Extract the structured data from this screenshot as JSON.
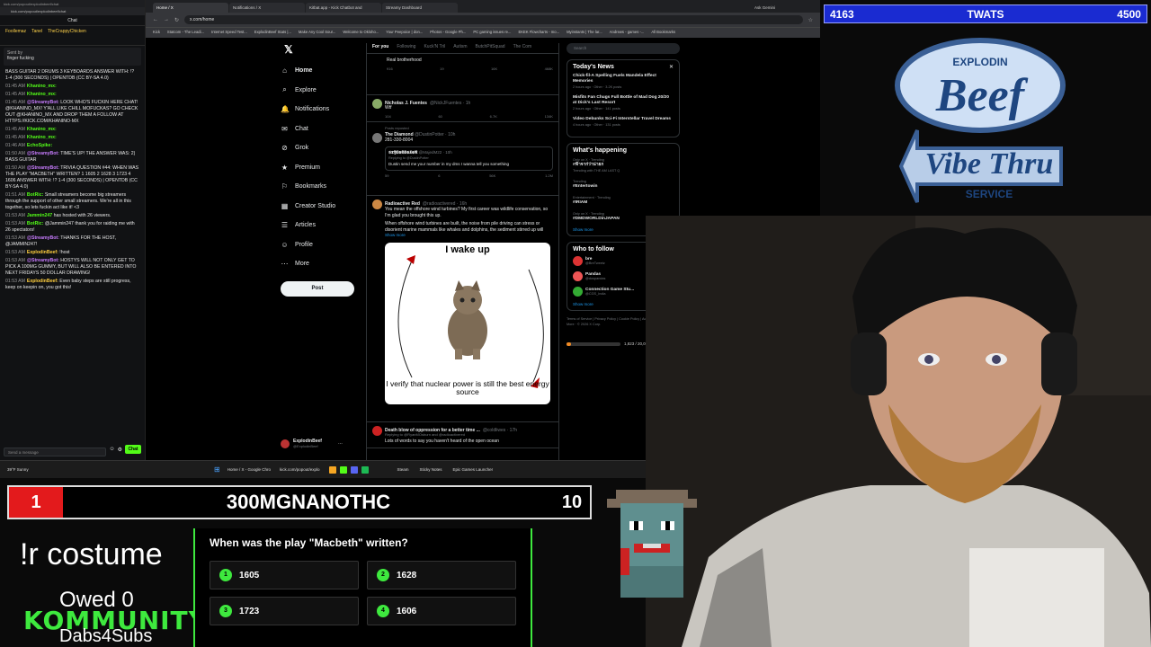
{
  "chat": {
    "url": "kick.com/popout/explodinbeef/chat",
    "title": "Chat",
    "top_gifters": [
      "Foollemaz",
      "Tanel",
      "TheCrappyChicken"
    ],
    "sent_by": "Sent by",
    "pinned_text": "finger fucking",
    "messages": [
      {
        "t": "",
        "u": "",
        "x": "BASS GUITAR 2 DRUMS 3 KEYBOARDS ANSWER WITH: !? 1-4 (300 SECONDS) | OPENTDB (CC BY-SA 4.0)"
      },
      {
        "t": "01:45 AM",
        "u": "Khanino_mx:",
        "x": ""
      },
      {
        "t": "01:45 AM",
        "u": "Khanino_mx:",
        "x": ""
      },
      {
        "t": "01:45 AM",
        "u": "@StreamyBot:",
        "x": "LOOK WHO'S FUCKIN HERE CHAT! @KHANINO_MX! Y'ALL LIKE CHILL MOFUCKAS? GO CHECK OUT @KHANINO_MX AND DROP THEM A FOLLOW AT HTTPS://KICK.COM/KHANINO-MX"
      },
      {
        "t": "01:45 AM",
        "u": "Khanino_mx:",
        "x": ""
      },
      {
        "t": "01:45 AM",
        "u": "Khanino_mx:",
        "x": ""
      },
      {
        "t": "01:46 AM",
        "u": "EchoSpike:",
        "x": ""
      },
      {
        "t": "01:50 AM",
        "u": "@StreamyBot:",
        "x": "TIME'S UP! THE ANSWER WAS: 2) BASS GUITAR"
      },
      {
        "t": "01:50 AM",
        "u": "@StreamyBot:",
        "x": "TRIVIA QUESTION #44: WHEN WAS THE PLAY \"MACBETH\" WRITTEN? 1 1605 2 1628 3 1723 4 1606 ANSWER WITH: !? 1-4 (300 SECONDS) | OPENTDB (CC BY-SA 4.0)"
      },
      {
        "t": "01:51 AM",
        "u": "BotRic:",
        "x": "Small streamers become big streamers through the support of other small streamers. We're all in this together, so lets fuckin act like it! <3"
      },
      {
        "t": "01:53 AM",
        "u": "Jammin247",
        "x": "has hosted with 26 viewers."
      },
      {
        "t": "01:53 AM",
        "u": "BotRic:",
        "x": "@Jammin247 thank you for raiding me with 26 spectators!"
      },
      {
        "t": "01:53 AM",
        "u": "@StreamyBot:",
        "x": "THANKS FOR THE HOST, @JAMMIN247!"
      },
      {
        "t": "01:53 AM",
        "u": "ExplodinBeef:",
        "x": "!host"
      },
      {
        "t": "01:53 AM",
        "u": "@StreamyBot:",
        "x": "HOSTYS WILL NOT ONLY GET TO PICK A 100MG GUMMY, BUT WILL ALSO BE ENTERED INTO NEXT FRIDAYS 50 DOLLAR DRAWING!"
      },
      {
        "t": "01:53 AM",
        "u": "ExplodinBeef:",
        "x": "Even baby steps are still progress, keep on keepin on, you got this!"
      }
    ],
    "input_placeholder": "Send a message",
    "chat_button": "Chat"
  },
  "browser": {
    "tabs": [
      "Home / X",
      "Notifications / X",
      "Kitbat.app - Kick Chatbot and",
      "Streamy Dashboard"
    ],
    "ask_gemini": "Ask Gemini",
    "url": "x.com/home",
    "bookmarks": [
      "Kick",
      "Statcom - The Leadi...",
      "Internet Speed Test...",
      "ExplodinBeef Stats |...",
      "Make Any Cool Sour...",
      "Welcome to Okloho...",
      "Your Peepoice | don...",
      "Photos - Google Ph...",
      "PC gaming issues re...",
      "EKEK Flowcharts - mo...",
      "Myinstants | The lar...",
      "Andrews - games -...",
      "All Bookmarks"
    ]
  },
  "x": {
    "nav": [
      "Home",
      "Explore",
      "Notifications",
      "Chat",
      "Grok",
      "Premium",
      "Bookmarks",
      "Creator Studio",
      "Articles",
      "Profile",
      "More"
    ],
    "post_button": "Post",
    "account_name": "ExplodinBeef",
    "account_handle": "@ExplodinBeef",
    "feed_tabs": [
      "For you",
      "Following",
      "Kuck'N Tril",
      "Autism",
      "ButchPitSquad",
      "The Com"
    ],
    "posts": [
      {
        "text": "Real brotherhood",
        "stats": [
          "916",
          "19",
          "16K",
          "468K"
        ]
      },
      {
        "name": "Nicholas J. Fuentes",
        "handle": "@NickJFuentes · 1h",
        "text": "Wtf",
        "stats": [
          "104",
          "60",
          "6.7K",
          "134K"
        ]
      },
      {
        "repost": "Posts reposted",
        "name": "The Diamond",
        "handle": "@DustinPotter · 10h",
        "text": "281-330-8004",
        "quote_name": "𝕾𝕿𝖄𝕷𝕰𝕭𝕷𝕰𝖃𝕰𝕽",
        "quote_handle": "@MajedM22 · 10h",
        "quote_reply": "Replying to @DustinPotter",
        "quote_text": "Dustin send me your number in my dms I wanna tell you something",
        "stats": [
          "59",
          "6",
          "56K",
          "1.2M"
        ]
      },
      {
        "name": "Radioactive Red",
        "handle": "@radioactivered · 16h",
        "text": "You mean the offshore wind turbines? My first career was wildlife conservation, so I'm glad you brought this up.",
        "text2": "When offshore wind turbines are built, the noise from pile driving can stress or disorient marine mammals like whales and dolphins, the sediment stirred up will",
        "showmore": "Show more",
        "meme_top": "I wake up",
        "meme_bottom": "I verify that nuclear power is still the best energy source"
      },
      {
        "name": "Death blow of oppression for a better time ...",
        "handle": "@coldliwes · 17h",
        "reply": "Replying to @RyanMOsburn and @radioactivered",
        "text": "Lots of words to say you haven't heard of the open ocean"
      }
    ],
    "search_placeholder": "Search",
    "todays_news_title": "Today's News",
    "news": [
      {
        "title": "Chick-fil-A Spelling Fuels Mandela Effect Memories",
        "meta": "2 hours ago · Other · 3.2K posts"
      },
      {
        "title": "Misfits Fan Chugs Full Bottle of Mad Dog 20/20 at Dick's Last Resort",
        "meta": "2 hours ago · Other · 141 posts"
      },
      {
        "title": "Video Debunks Sci-Fi Interstellar Travel Dreams",
        "meta": "4 hours ago · Other · 131 posts"
      }
    ],
    "happening_title": "What's happening",
    "trends": [
      {
        "cat": "Only on X · Trending",
        "name": "#ฟ้าจาก่ว่าน่ายก",
        "sub": "Trending with THE AM LAST Q"
      },
      {
        "cat": "Trending",
        "name": "#Entertowin",
        "sub": ""
      },
      {
        "cat": "Entertainment · Trending",
        "name": "#IRIAM",
        "sub": ""
      },
      {
        "cat": "Only on X · Trending",
        "name": "#DMDWORLDinJAPAN",
        "sub": ""
      }
    ],
    "show_more": "Show more",
    "who_to_follow_title": "Who to follow",
    "follows": [
      {
        "name": "bre",
        "handle": "@BreTweetz"
      },
      {
        "name": "Pandas",
        "handle": "@dospandas"
      },
      {
        "name": "Connection Game Stu...",
        "handle": "@CGS_India"
      }
    ],
    "follow_label": "Follow",
    "footer": "Terms of Service | Privacy Policy | Cookie Policy | Accessibility | Ads info | More · © 2026 X Corp.",
    "hp_text": "1,823 / 20,000 HP"
  },
  "taskbar": {
    "weather": "39°F Sunny",
    "items": [
      "Home / X - Google Chro",
      "kick.com/popout/explo",
      "Steam",
      "Sticky Notes",
      "Epic Games Launcher"
    ],
    "time": "1:53 AM",
    "date": "3/22/2026"
  },
  "overlay": {
    "left_score": "4163",
    "title": "TWATS",
    "right_score": "4500",
    "logo_line1": "EXPLODIN",
    "logo_line2": "Beef",
    "logo_line3": "Vibe Thru",
    "logo_line4": "SERVICE",
    "rank": "1",
    "leader_name": "300MGNANOTHC",
    "leader_score": "10",
    "command": "!r costume",
    "owed": "Owed 0",
    "kommunity": "KOMMUNITY",
    "dabs": "Dabs4Subs",
    "question": "When was the play \"Macbeth\" written?",
    "answers": [
      {
        "n": "1",
        "v": "1605"
      },
      {
        "n": "2",
        "v": "1628"
      },
      {
        "n": "3",
        "v": "1723"
      },
      {
        "n": "4",
        "v": "1606"
      }
    ],
    "accent_green": "#3ee93e",
    "accent_red": "#e31a1c",
    "accent_blue": "#1a2bd1"
  }
}
